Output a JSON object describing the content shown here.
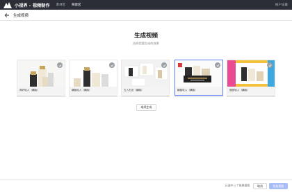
{
  "topbar": {
    "app_name": "小视界 - 视频制作",
    "nav": [
      {
        "label": "素材区",
        "active": false
      },
      {
        "label": "探索区",
        "active": true
      }
    ],
    "right_link": "帐户设置"
  },
  "header": {
    "title": "生成视频"
  },
  "main": {
    "title": "生成视频",
    "subtitle": "选择您要生成的效果"
  },
  "cards": [
    {
      "label": "简约轮入（横版）",
      "selected": false,
      "theme": "white",
      "icon": "check-icon"
    },
    {
      "label": "横板轮入（横版）",
      "selected": false,
      "theme": "white",
      "icon": "check-icon"
    },
    {
      "label": "左入右出（横版）",
      "selected": false,
      "theme": "collage",
      "icon": "check-icon"
    },
    {
      "label": "横板轮入（横版）",
      "selected": true,
      "theme": "promo",
      "icon": "check-icon"
    },
    {
      "label": "缩放轮入（横版）",
      "selected": false,
      "theme": "colorful",
      "icon": "check-icon"
    }
  ],
  "generate_button": "继续生成",
  "footer": {
    "count_text": "已选中 0 个效果视频",
    "cancel_label": "取消",
    "primary_label": "保存视频"
  },
  "colors": {
    "topbar": "#2b2e36",
    "accent": "#5b7cf6",
    "primary_disabled": "#a9bdf6"
  }
}
